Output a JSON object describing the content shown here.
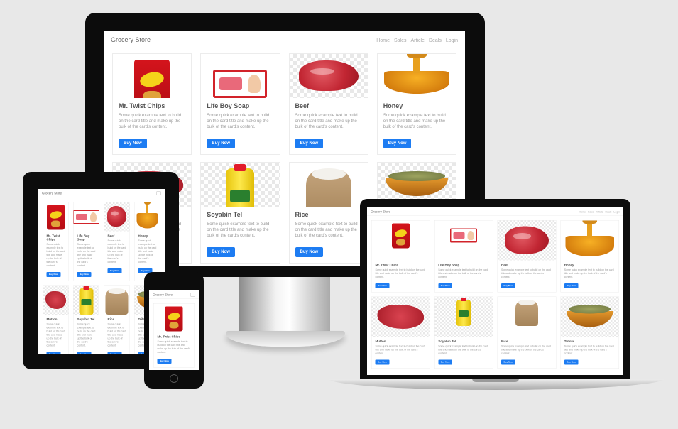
{
  "app": {
    "brand": "Grocery Store",
    "nav_links": [
      "Home",
      "Sales",
      "Article",
      "Deals",
      "Login"
    ],
    "card_text": "Some quick example text to build on the card title and make up the bulk of the card's content.",
    "button_label": "Buy Now"
  },
  "products": [
    {
      "name": "Mr. Twist Chips",
      "art": "chips-pack"
    },
    {
      "name": "Life Boy Soap",
      "art": "soap-box"
    },
    {
      "name": "Beef",
      "art": "beef-meat"
    },
    {
      "name": "Honey",
      "art": "honey-bowl"
    },
    {
      "name": "Mutton",
      "art": "mutton-meat"
    },
    {
      "name": "Soyabin Tel",
      "art": "oil-bottle"
    },
    {
      "name": "Rice",
      "art": "rice-sack"
    },
    {
      "name": "Trifola",
      "art": "bay-leaf-bowl"
    }
  ],
  "colors": {
    "button": "#1d7cf2",
    "background": "#e8e8e8",
    "bezel": "#0c0c0c"
  }
}
